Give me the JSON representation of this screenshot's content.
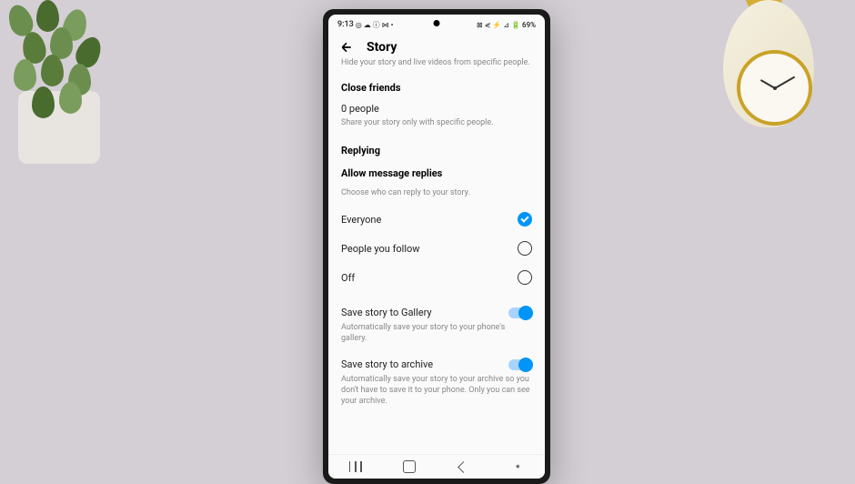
{
  "status": {
    "time": "9:13",
    "icons_left": "◎ ☁ ⓘ ⋈ •",
    "icons_right": "⊠ ⋞ ⚡ ⊿ 🔋",
    "battery": "69%"
  },
  "header": {
    "title": "Story"
  },
  "hide_hint": "Hide your story and live videos from specific people.",
  "close_friends": {
    "title": "Close friends",
    "count": "0 people",
    "hint": "Share your story only with specific people."
  },
  "replying": {
    "title": "Replying",
    "allow_title": "Allow message replies",
    "allow_hint": "Choose who can reply to your story.",
    "options": {
      "everyone": "Everyone",
      "following": "People you follow",
      "off": "Off"
    },
    "selected": "everyone"
  },
  "save_gallery": {
    "label": "Save story to Gallery",
    "hint": "Automatically save your story to your phone's gallery.",
    "enabled": true
  },
  "save_archive": {
    "label": "Save story to archive",
    "hint": "Automatically save your story to your archive so you don't have to save it to your phone. Only you can see your archive.",
    "enabled": true
  }
}
